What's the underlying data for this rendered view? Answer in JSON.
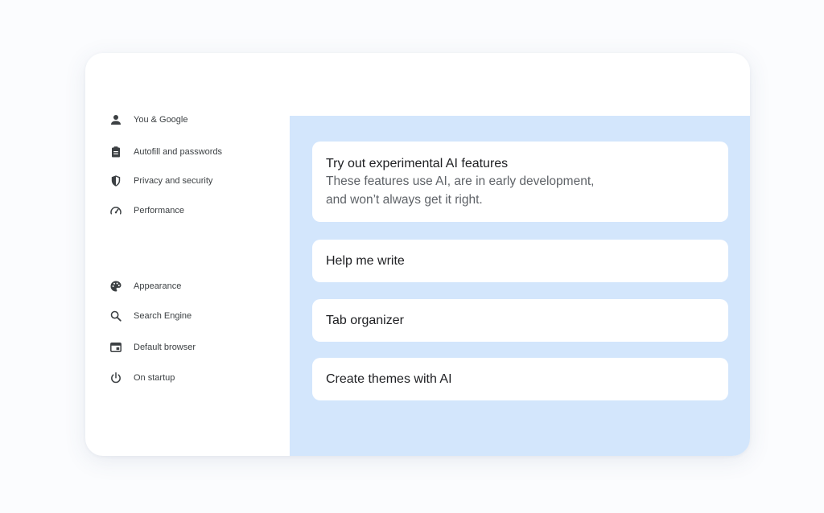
{
  "sidebar": {
    "items": [
      {
        "label": "You & Google",
        "icon": "person-icon"
      },
      {
        "label": "Autofill and passwords",
        "icon": "clipboard-icon"
      },
      {
        "label": "Privacy and security",
        "icon": "shield-icon"
      },
      {
        "label": "Performance",
        "icon": "speedometer-icon"
      },
      {
        "label": "Appearance",
        "icon": "palette-icon"
      },
      {
        "label": "Search Engine",
        "icon": "search-icon"
      },
      {
        "label": "Default browser",
        "icon": "browser-window-icon"
      },
      {
        "label": "On startup",
        "icon": "power-icon"
      }
    ]
  },
  "main": {
    "intro": {
      "title": "Try out experimental AI features",
      "description": "These features use AI, are in early development, and won’t always get it right."
    },
    "features": [
      {
        "label": "Help me write"
      },
      {
        "label": "Tab organizer"
      },
      {
        "label": "Create themes with AI"
      }
    ]
  },
  "colors": {
    "panel_background": "#d3e6fc",
    "text_primary": "#202124",
    "text_secondary": "#5f6368"
  }
}
